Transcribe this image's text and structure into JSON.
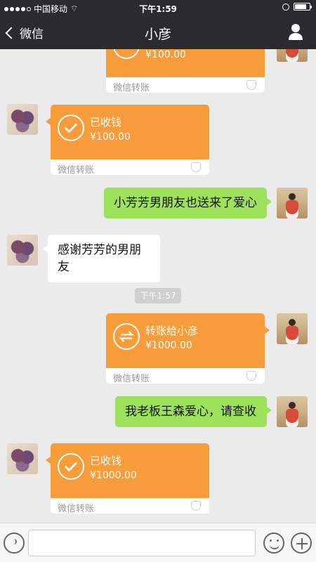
{
  "status": {
    "carrier": "中国移动",
    "time": "下午1:59"
  },
  "nav": {
    "back_label": "微信",
    "title": "小彦"
  },
  "messages": [
    {
      "type": "transfer",
      "side": "right",
      "title": "",
      "amount": "¥100.00",
      "footer": "微信转账"
    },
    {
      "type": "transfer",
      "side": "left",
      "title": "已收钱",
      "amount": "¥100.00",
      "footer": "微信转账"
    },
    {
      "type": "text",
      "side": "right",
      "text": "小芳芳男朋友也送来了爱心"
    },
    {
      "type": "text",
      "side": "left",
      "text": "感谢芳芳的男朋友"
    },
    {
      "type": "time",
      "text": "下午1:57"
    },
    {
      "type": "transfer",
      "side": "right",
      "title": "转账给小彦",
      "amount": "¥1000.00",
      "footer": "微信转账"
    },
    {
      "type": "text",
      "side": "right",
      "text": "我老板王森爱心，请查收"
    },
    {
      "type": "transfer",
      "side": "left",
      "title": "已收钱",
      "amount": "¥1000.00",
      "footer": "微信转账"
    }
  ]
}
